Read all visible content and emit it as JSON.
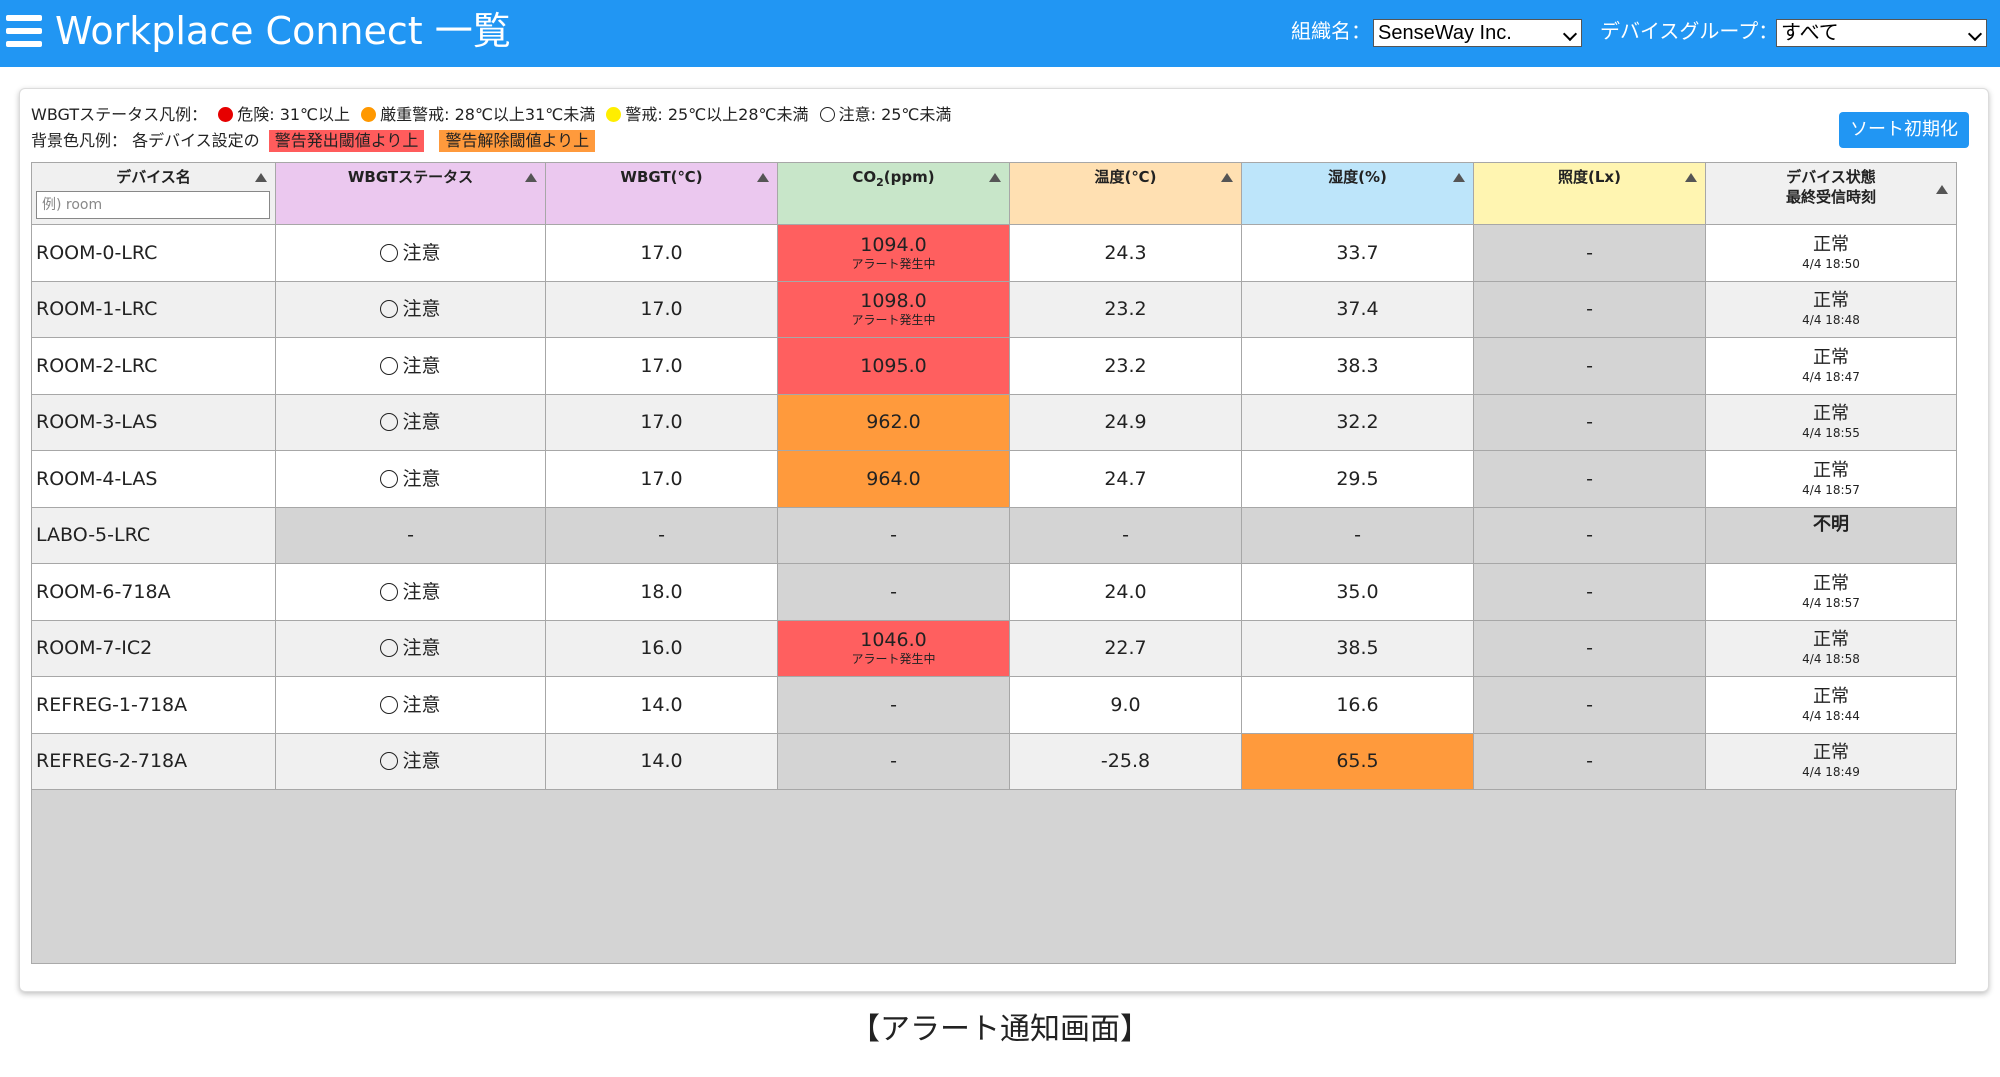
{
  "header": {
    "title": "Workplace Connect 一覧",
    "org_label": "組織名：",
    "org_value": "SenseWay Inc.",
    "group_label": "デバイスグループ：",
    "group_value": "すべて",
    "bar_color": "#2196f3"
  },
  "legend": {
    "wbgt_label": "WBGTステータス凡例：",
    "danger": "危険: 31℃以上",
    "severe": "厳重警戒: 28℃以上31℃未満",
    "warning": "警戒: 25℃以上28℃未満",
    "caution": "注意: 25℃未満",
    "bg_label": "背景色凡例： 各デバイス設定の",
    "bg_alert": "警告発出閾値より上",
    "bg_release": "警告解除閾値より上",
    "colors": {
      "danger": "#e60000",
      "severe": "#ff9800",
      "warning": "#ffee00",
      "alert_bg": "#ff5f5f",
      "release_bg": "#ff9a3c"
    }
  },
  "sort_reset_label": "ソート初期化",
  "columns": {
    "name": "デバイス名",
    "name_placeholder": "例) room",
    "wbgt_status": "WBGTステータス",
    "wbgt": "WBGT(℃)",
    "co2_prefix": "CO",
    "co2_sub": "2",
    "co2_suffix": "(ppm)",
    "temp": "温度(℃)",
    "humidity": "湿度(%)",
    "lux": "照度(Lx)",
    "state_line1": "デバイス状態",
    "state_line2": "最終受信時刻"
  },
  "rows": [
    {
      "name": "ROOM-0-LRC",
      "status": "注意",
      "wbgt": "17.0",
      "co2": "1094.0",
      "co2_note": "アラート発生中",
      "temp": "24.3",
      "humidity": "33.7",
      "lux": "-",
      "state": "正常",
      "time": "4/4 18:50"
    },
    {
      "name": "ROOM-1-LRC",
      "status": "注意",
      "wbgt": "17.0",
      "co2": "1098.0",
      "co2_note": "アラート発生中",
      "temp": "23.2",
      "humidity": "37.4",
      "lux": "-",
      "state": "正常",
      "time": "4/4 18:48"
    },
    {
      "name": "ROOM-2-LRC",
      "status": "注意",
      "wbgt": "17.0",
      "co2": "1095.0",
      "co2_note": "",
      "temp": "23.2",
      "humidity": "38.3",
      "lux": "-",
      "state": "正常",
      "time": "4/4 18:47"
    },
    {
      "name": "ROOM-3-LAS",
      "status": "注意",
      "wbgt": "17.0",
      "co2": "962.0",
      "co2_note": "",
      "temp": "24.9",
      "humidity": "32.2",
      "lux": "-",
      "state": "正常",
      "time": "4/4 18:55"
    },
    {
      "name": "ROOM-4-LAS",
      "status": "注意",
      "wbgt": "17.0",
      "co2": "964.0",
      "co2_note": "",
      "temp": "24.7",
      "humidity": "29.5",
      "lux": "-",
      "state": "正常",
      "time": "4/4 18:57"
    },
    {
      "name": "LABO-5-LRC",
      "status": "-",
      "wbgt": "-",
      "co2": "-",
      "co2_note": "",
      "temp": "-",
      "humidity": "-",
      "lux": "-",
      "state": "不明",
      "time": ""
    },
    {
      "name": "ROOM-6-718A",
      "status": "注意",
      "wbgt": "18.0",
      "co2": "-",
      "co2_note": "",
      "temp": "24.0",
      "humidity": "35.0",
      "lux": "-",
      "state": "正常",
      "time": "4/4 18:57"
    },
    {
      "name": "ROOM-7-IC2",
      "status": "注意",
      "wbgt": "16.0",
      "co2": "1046.0",
      "co2_note": "アラート発生中",
      "temp": "22.7",
      "humidity": "38.5",
      "lux": "-",
      "state": "正常",
      "time": "4/4 18:58"
    },
    {
      "name": "REFREG-1-718A",
      "status": "注意",
      "wbgt": "14.0",
      "co2": "-",
      "co2_note": "",
      "temp": "9.0",
      "humidity": "16.6",
      "lux": "-",
      "state": "正常",
      "time": "4/4 18:44"
    },
    {
      "name": "REFREG-2-718A",
      "status": "注意",
      "wbgt": "14.0",
      "co2": "-",
      "co2_note": "",
      "temp": "-25.8",
      "humidity": "65.5",
      "lux": "-",
      "state": "正常",
      "time": "4/4 18:49"
    }
  ],
  "cell_highlights": {
    "co2": [
      "alert-red",
      "alert-red",
      "alert-red",
      "alert-orange",
      "alert-orange",
      "na",
      "na",
      "alert-red",
      "na",
      "na"
    ],
    "humidity": [
      "",
      "",
      "",
      "",
      "",
      "na",
      "",
      "",
      "",
      "alert-orange"
    ]
  },
  "caption": "【アラート通知画面】"
}
